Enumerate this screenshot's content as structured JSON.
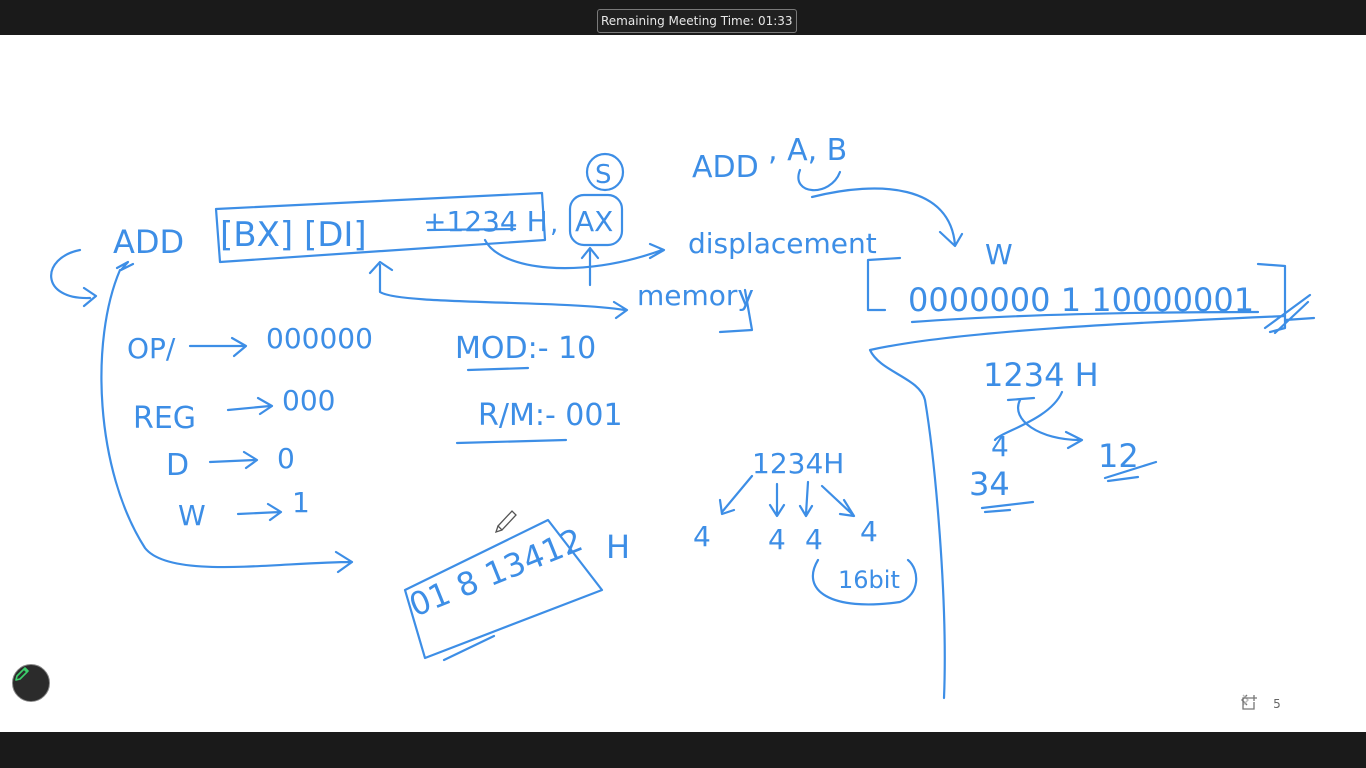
{
  "meeting": {
    "remaining_time_label": "Remaining Meeting Time: 01:33"
  },
  "whiteboard": {
    "ink_color": "#3d8ee6",
    "instruction": {
      "mnemonic": "ADD",
      "operand_mem": "[BX] [DI]",
      "displacement": "+1234 H",
      "sep": ",",
      "operand_reg": "AX"
    },
    "source_mark": "S",
    "second_instruction": {
      "mnemonic": "ADD",
      "operands": ", A, B"
    },
    "labels": {
      "displacement": "displacement",
      "memory": "memory",
      "w_mark": "W"
    },
    "encoding_fields": [
      {
        "name": "OP/",
        "value": "000000"
      },
      {
        "name": "REG",
        "value": "000"
      },
      {
        "name": "D",
        "value": "0"
      },
      {
        "name": "W",
        "value": "1"
      }
    ],
    "mod": "MOD:- 10",
    "rm": "R/M:- 001",
    "machine_code_binary": "0000000 1 10000001",
    "result_hex": "01 8 13412",
    "result_hex_suffix": "H",
    "split_value": "1234H",
    "split_digits": [
      "4",
      "4",
      "4",
      "4"
    ],
    "split_note": "16bit",
    "byte_swap": {
      "value": "1234 H",
      "low_byte": "34",
      "high_byte": "12",
      "low_digit": "4"
    }
  },
  "pager": {
    "page": "5"
  },
  "icons": {
    "edit": "pencil-icon",
    "prev": "chevron-left-icon",
    "next": "chevron-right-icon",
    "new_page": "add-page-icon",
    "cursor": "pen-cursor-icon"
  }
}
